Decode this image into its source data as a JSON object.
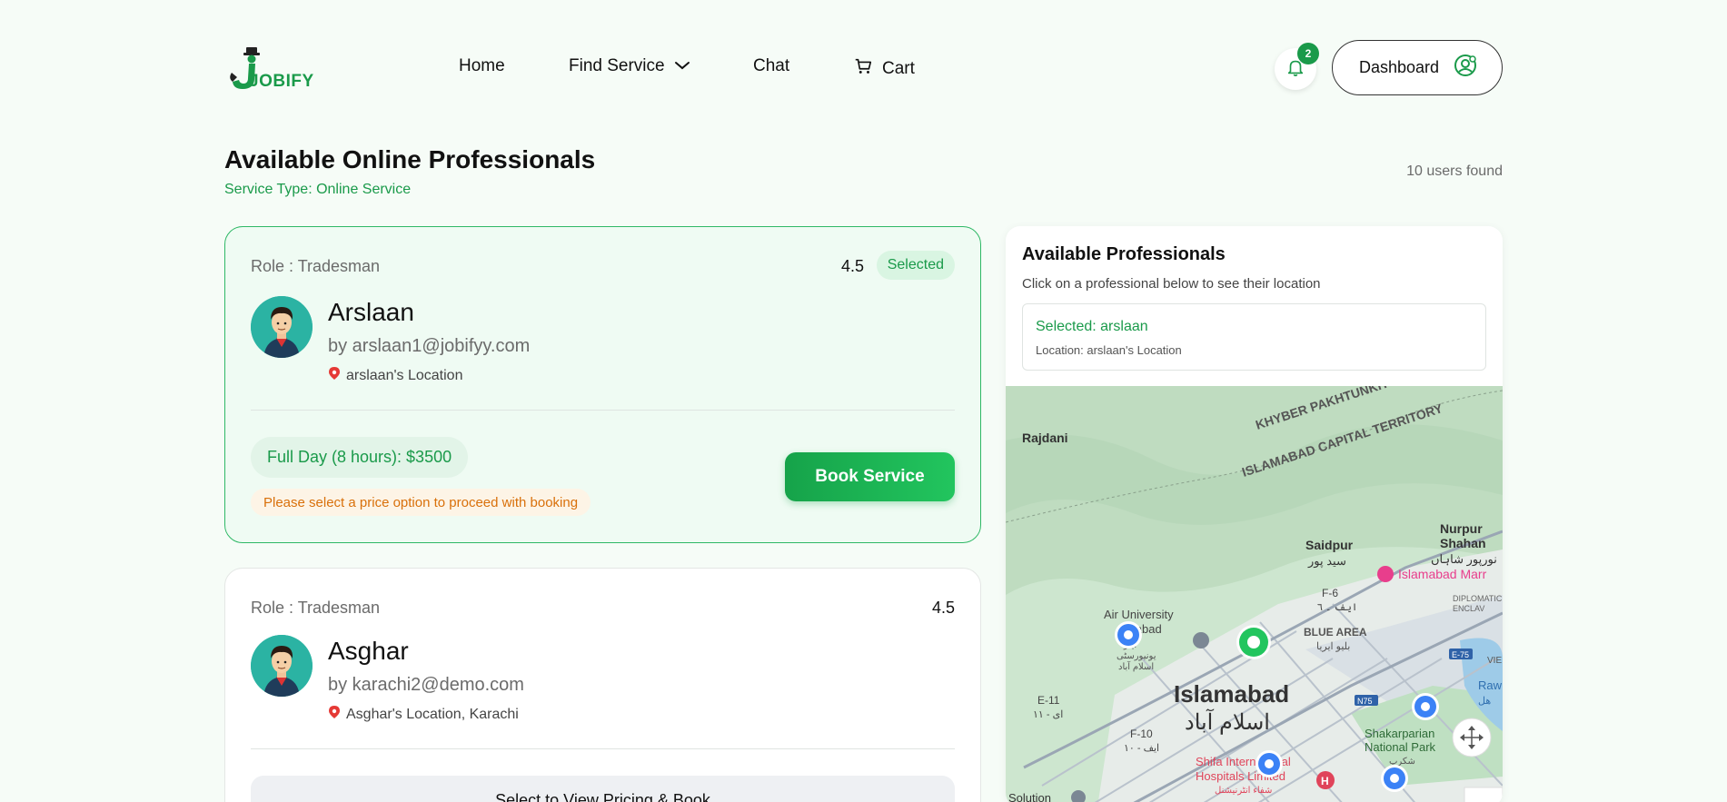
{
  "brand": {
    "logo_text": "JOBIFY"
  },
  "nav": {
    "home": "Home",
    "find_service": "Find Service",
    "chat": "Chat",
    "cart": "Cart"
  },
  "header": {
    "notification_count": "2",
    "dashboard_label": "Dashboard"
  },
  "page": {
    "title": "Available Online Professionals",
    "subtitle": "Service Type: Online Service",
    "users_found": "10 users found"
  },
  "professionals": [
    {
      "role": "Role : Tradesman",
      "rating": "4.5",
      "selected_label": "Selected",
      "name": "Arslaan",
      "email": "by arslaan1@jobifyy.com",
      "location": "arslaan's Location",
      "price_option": "Full Day (8 hours): $3500",
      "warning": "Please select a price option to proceed with booking",
      "book_label": "Book Service"
    },
    {
      "role": "Role : Tradesman",
      "rating": "4.5",
      "name": "Asghar",
      "email": "by karachi2@demo.com",
      "location": "Asghar's Location, Karachi",
      "select_label": "Select to View Pricing & Book"
    }
  ],
  "map_panel": {
    "title": "Available Professionals",
    "subtitle": "Click on a professional below to see their location",
    "selected_name": "Selected: arslaan",
    "selected_location": "Location: arslaan's Location",
    "labels": {
      "rajdani": "Rajdani",
      "kp": "KHYBER PAKHTUNKH",
      "ict": "ISLAMABAD CAPITAL TERRITORY",
      "nurpur": "Nurpur",
      "shahan": "Shahan",
      "nurpur_ur": "نورپور شاہاں",
      "saidpur": "Saidpur",
      "saidpur_ur": "سید پور",
      "marriott": "Islamabad Marr",
      "diplomatic": "DIPLOMATIC",
      "enclave": "ENCLAV",
      "f6": "F-6",
      "f6_ur": "ایف ۔ ٦",
      "air_university": "Air University",
      "air_ur": "mabad",
      "air_ur2": "ایئر",
      "air_ur3": "یونیورسٹی",
      "air_ur4": "اسلام آباد",
      "blue_area": "BLUE AREA",
      "blue_area_ur": "بلیو ایریا",
      "e75": "E-75",
      "n75": "N75",
      "islamabad": "Islamabad",
      "islamabad_ur": "اسلام آباد",
      "e11": "E-11",
      "e11_ur": "ای - ١١",
      "f10": "F-10",
      "f10_ur": "ایف - ١٠",
      "shakarparian": "Shakarparian",
      "national_park": "National Park",
      "shakar_ur": "شکرپ",
      "shifa": "Shifa International",
      "hospitals": "Hospitals Limited",
      "shifa_ur": "شفاء انٹرنیشنل",
      "solution": "Solution",
      "raw": "Raw",
      "vie": "VIE",
      "hal": "ھل"
    }
  },
  "colors": {
    "accent": "#1a9a4a",
    "background": "#f6fcf7",
    "warning": "#d9700a",
    "map_marker": "#3b82f6",
    "map_selected": "#22c55e"
  },
  "icons": {
    "find_service": "chevron-down-icon",
    "cart": "cart-icon",
    "notifications": "bell-icon",
    "dashboard": "user-circle-icon",
    "location": "location-pin-icon",
    "map_fullscreen": "move-arrows-icon"
  }
}
